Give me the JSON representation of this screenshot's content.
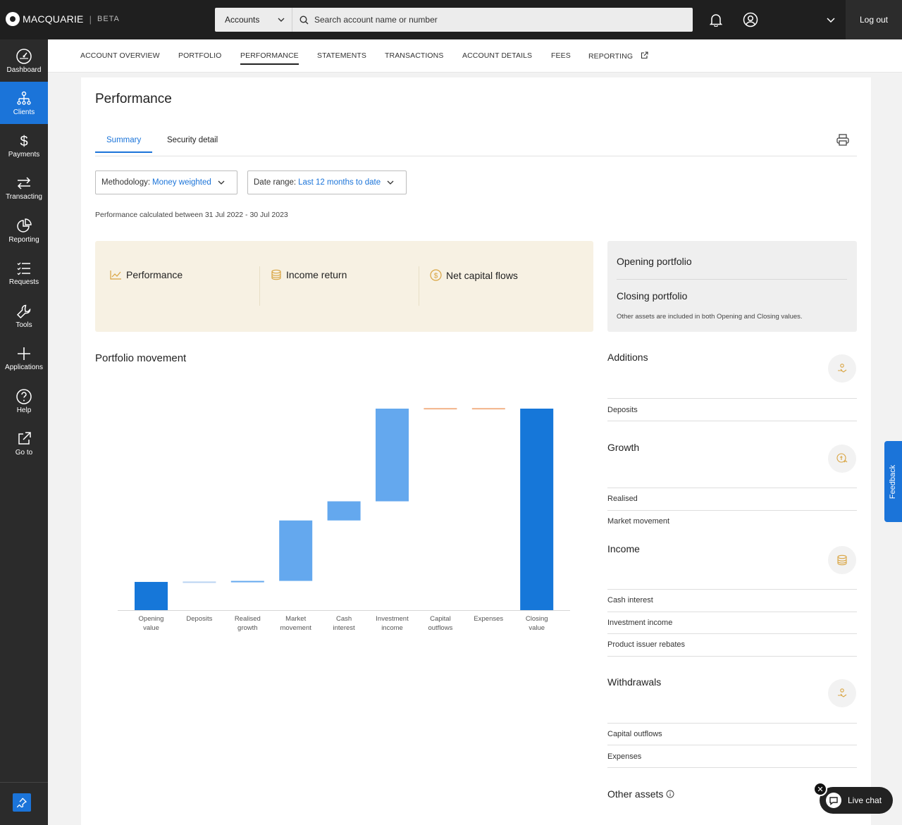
{
  "header": {
    "brand": "MACQUARIE",
    "beta": "BETA",
    "search_scope": "Accounts",
    "search_placeholder": "Search account name or number",
    "logout_label": "Log out"
  },
  "sidebar": {
    "items": [
      {
        "label": "Dashboard",
        "icon": "dashboard-icon"
      },
      {
        "label": "Clients",
        "icon": "clients-icon",
        "active": true
      },
      {
        "label": "Payments",
        "icon": "dollar-icon"
      },
      {
        "label": "Transacting",
        "icon": "transfer-icon"
      },
      {
        "label": "Reporting",
        "icon": "pie-chart-icon"
      },
      {
        "label": "Requests",
        "icon": "list-icon"
      },
      {
        "label": "Tools",
        "icon": "wrench-icon"
      },
      {
        "label": "Applications",
        "icon": "plus-icon"
      },
      {
        "label": "Help",
        "icon": "help-icon"
      },
      {
        "label": "Go to",
        "icon": "external-link-icon"
      }
    ]
  },
  "subnav": {
    "items": [
      "ACCOUNT OVERVIEW",
      "PORTFOLIO",
      "PERFORMANCE",
      "STATEMENTS",
      "TRANSACTIONS",
      "ACCOUNT DETAILS",
      "FEES",
      "REPORTING"
    ],
    "active": "PERFORMANCE"
  },
  "page": {
    "title": "Performance",
    "tabs": [
      "Summary",
      "Security detail"
    ],
    "active_tab": "Summary",
    "methodology_label": "Methodology:",
    "methodology_value": "Money weighted",
    "date_range_label": "Date range:",
    "date_range_value": "Last 12 months to date",
    "calculated_text": "Performance calculated between 31 Jul 2022 - 30 Jul 2023"
  },
  "summary": {
    "metrics": [
      "Performance",
      "Income return",
      "Net capital flows"
    ]
  },
  "portfolio_panel": {
    "opening": "Opening portfolio",
    "closing": "Closing portfolio",
    "note": "Other assets are included in both Opening and Closing values."
  },
  "movement": {
    "title": "Portfolio movement"
  },
  "chart_data": {
    "type": "bar",
    "categories": [
      [
        "Opening",
        "value"
      ],
      [
        "Deposits"
      ],
      [
        "Realised",
        "growth"
      ],
      [
        "Market",
        "movement"
      ],
      [
        "Cash",
        "interest"
      ],
      [
        "Investment",
        "income"
      ],
      [
        "Capital",
        "outflows"
      ],
      [
        "Expenses"
      ],
      [
        "Closing",
        "value"
      ]
    ],
    "series": [
      {
        "kind": "total",
        "start": 0,
        "end": 14,
        "color": "#1677d9"
      },
      {
        "kind": "step",
        "start": 14,
        "end": 14.2,
        "color": "#b9d3f2"
      },
      {
        "kind": "step",
        "start": 14.2,
        "end": 14.5,
        "color": "#64a8ee"
      },
      {
        "kind": "step",
        "start": 14.5,
        "end": 44.5,
        "color": "#64a8ee"
      },
      {
        "kind": "step",
        "start": 44.5,
        "end": 54,
        "color": "#64a8ee"
      },
      {
        "kind": "step",
        "start": 54,
        "end": 100,
        "color": "#64a8ee"
      },
      {
        "kind": "step",
        "start": 100,
        "end": 100.3,
        "color": "#f2b48a"
      },
      {
        "kind": "step",
        "start": 100,
        "end": 100.3,
        "color": "#f2b48a"
      },
      {
        "kind": "total",
        "start": 0,
        "end": 100,
        "color": "#1677d9"
      }
    ],
    "ylim": [
      0,
      100
    ],
    "title": "",
    "xlabel": "",
    "ylabel": ""
  },
  "breakdown": {
    "additions": {
      "title": "Additions",
      "rows": [
        "Deposits"
      ]
    },
    "growth": {
      "title": "Growth",
      "rows": [
        "Realised",
        "Market movement"
      ]
    },
    "income": {
      "title": "Income",
      "rows": [
        "Cash interest",
        "Investment income",
        "Product issuer rebates"
      ]
    },
    "withdrawals": {
      "title": "Withdrawals",
      "rows": [
        "Capital outflows",
        "Expenses"
      ]
    },
    "other_assets": "Other assets"
  },
  "floating": {
    "feedback": "Feedback",
    "live_chat": "Live chat"
  },
  "colors": {
    "accent": "#1b74d9",
    "summary_bg": "#f7f1e3",
    "icon_gold": "#d9a441"
  }
}
